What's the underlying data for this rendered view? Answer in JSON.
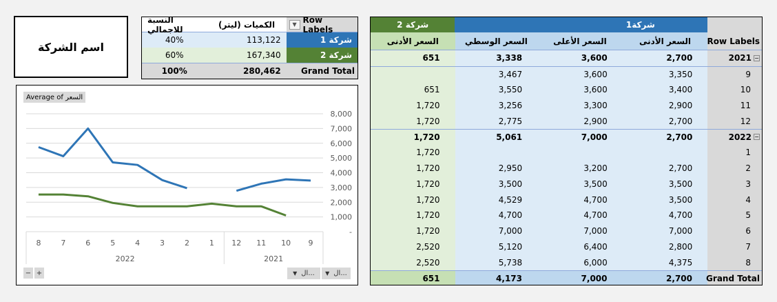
{
  "company_label": "اسم الشركة",
  "summary_pivot": {
    "headers": {
      "row_labels": "Row Labels",
      "quantity": "الكميات (ليتر)",
      "share": "النسبة للاجمالي"
    },
    "rows": [
      {
        "label": "شركة 1",
        "quantity": "113,122",
        "share": "40%",
        "color": "#2e75b6"
      },
      {
        "label": "شركة 2",
        "quantity": "167,340",
        "share": "60%",
        "color": "#548235"
      }
    ],
    "total": {
      "label": "Grand Total",
      "quantity": "280,462",
      "share": "100%"
    }
  },
  "chart_data": {
    "type": "line",
    "title": "",
    "field_button": "Average of السعر",
    "categories": [
      "8",
      "7",
      "6",
      "5",
      "4",
      "3",
      "2",
      "1",
      "12",
      "11",
      "10",
      "9"
    ],
    "category_groups": [
      {
        "label": "2022",
        "items": [
          "8",
          "7",
          "6",
          "5",
          "4",
          "3",
          "2",
          "1"
        ]
      },
      {
        "label": "2021",
        "items": [
          "12",
          "11",
          "10",
          "9"
        ]
      }
    ],
    "series": [
      {
        "color": "#2e75b6",
        "values": [
          5738,
          5120,
          7000,
          4700,
          4529,
          3500,
          2950,
          null,
          2775,
          3256,
          3550,
          3467
        ]
      },
      {
        "color": "#548235",
        "values": [
          2520,
          2520,
          2400,
          1950,
          1720,
          1720,
          1720,
          1900,
          1720,
          1720,
          1100,
          null
        ]
      }
    ],
    "ylim": [
      0,
      8000
    ],
    "y_ticks": [
      "-",
      "1,000",
      "2,000",
      "3,000",
      "4,000",
      "5,000",
      "6,000",
      "7,000",
      "8,000"
    ],
    "y_axis_position": "right",
    "grid": true,
    "filter_buttons": [
      "ال...",
      "ال..."
    ],
    "zoom_buttons": [
      "−",
      "+"
    ]
  },
  "main_pivot": {
    "group1": "شركة1",
    "group2": "شركة 2",
    "row_labels": "Row Labels",
    "col_min": "السعر الأدنى",
    "col_max": "السعر الأعلى",
    "col_mid": "السعر الوسطي",
    "col2_min": "السعر الأدنى",
    "rows": [
      {
        "label": "2021",
        "min": "2,700",
        "max": "3,600",
        "mid": "3,338",
        "c2": "651",
        "bold": true
      },
      {
        "label": "9",
        "min": "3,350",
        "max": "3,600",
        "mid": "3,467",
        "c2": ""
      },
      {
        "label": "10",
        "min": "3,400",
        "max": "3,600",
        "mid": "3,550",
        "c2": "651"
      },
      {
        "label": "11",
        "min": "2,900",
        "max": "3,300",
        "mid": "3,256",
        "c2": "1,720"
      },
      {
        "label": "12",
        "min": "2,700",
        "max": "2,900",
        "mid": "2,775",
        "c2": "1,720"
      },
      {
        "label": "2022",
        "min": "2,700",
        "max": "7,000",
        "mid": "5,061",
        "c2": "1,720",
        "bold": true
      },
      {
        "label": "1",
        "min": "",
        "max": "",
        "mid": "",
        "c2": "1,720"
      },
      {
        "label": "2",
        "min": "2,700",
        "max": "3,200",
        "mid": "2,950",
        "c2": "1,720"
      },
      {
        "label": "3",
        "min": "3,500",
        "max": "3,500",
        "mid": "3,500",
        "c2": "1,720"
      },
      {
        "label": "4",
        "min": "3,500",
        "max": "4,700",
        "mid": "4,529",
        "c2": "1,720"
      },
      {
        "label": "5",
        "min": "4,700",
        "max": "4,700",
        "mid": "4,700",
        "c2": "1,720"
      },
      {
        "label": "6",
        "min": "7,000",
        "max": "7,000",
        "mid": "7,000",
        "c2": "1,720"
      },
      {
        "label": "7",
        "min": "2,800",
        "max": "6,400",
        "mid": "5,120",
        "c2": "2,520"
      },
      {
        "label": "8",
        "min": "4,375",
        "max": "6,000",
        "mid": "5,738",
        "c2": "2,520"
      }
    ],
    "total": {
      "label": "Grand Total",
      "min": "2,700",
      "max": "7,000",
      "mid": "4,173",
      "c2": "651"
    }
  }
}
